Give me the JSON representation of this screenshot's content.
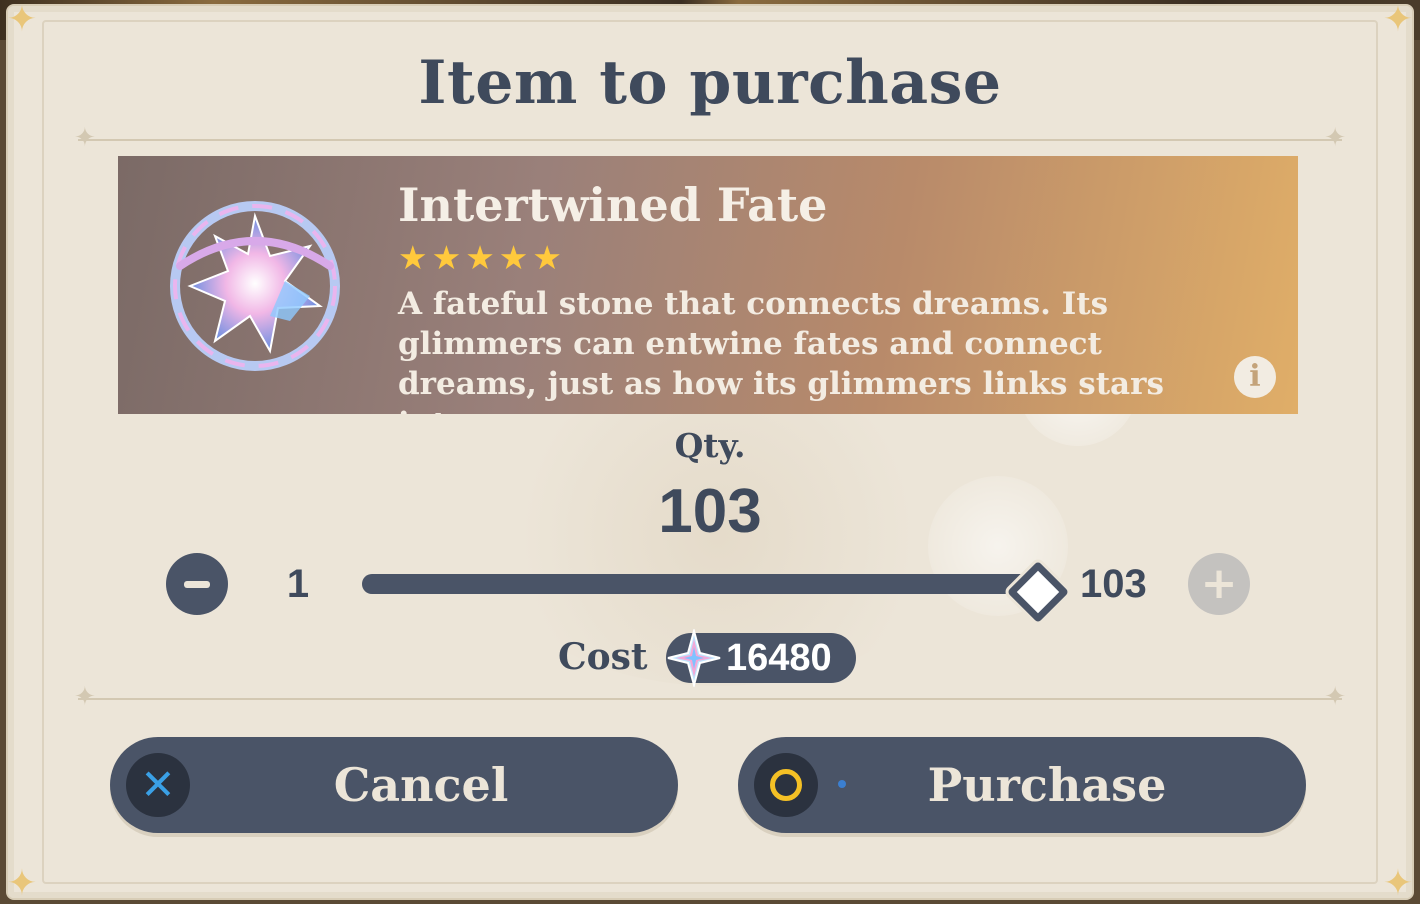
{
  "dialog": {
    "title": "Item to purchase"
  },
  "item": {
    "name": "Intertwined Fate",
    "rarity_stars": 5,
    "description": "A fateful stone that connects dreams. Its glimmers can entwine fates and connect dreams, just as how its glimmers links stars into",
    "info_icon": "info-icon"
  },
  "quantity": {
    "label": "Qty.",
    "value": "103",
    "min": "1",
    "max": "103",
    "fraction": 1.0
  },
  "cost": {
    "label": "Cost",
    "currency_icon": "primogem-icon",
    "value": "16480"
  },
  "buttons": {
    "cancel_label": "Cancel",
    "purchase_label": "Purchase"
  },
  "colors": {
    "accent": "#4a5467",
    "background": "#ece5d8",
    "star": "#ffc93c",
    "title_text": "#3f4a5c"
  }
}
